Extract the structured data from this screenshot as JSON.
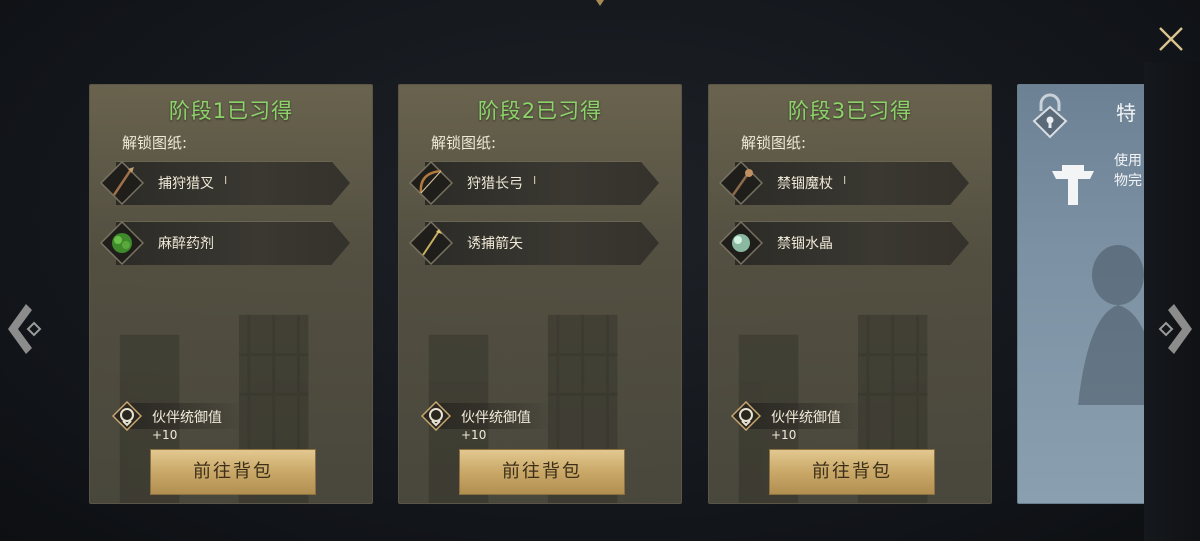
{
  "close": {
    "icon": "close-icon"
  },
  "cards": [
    {
      "title": "阶段1已习得",
      "unlock_label": "解锁图纸:",
      "items": [
        {
          "name": "捕狩猎叉",
          "tier": "I",
          "icon": "harpoon-icon"
        },
        {
          "name": "麻醉药剂",
          "tier": "",
          "icon": "herb-potion-icon"
        }
      ],
      "bonus_label": "伙伴统御值",
      "bonus_value": "+10",
      "button": "前往背包"
    },
    {
      "title": "阶段2已习得",
      "unlock_label": "解锁图纸:",
      "items": [
        {
          "name": "狩猎长弓",
          "tier": "I",
          "icon": "longbow-icon"
        },
        {
          "name": "诱捕箭矢",
          "tier": "",
          "icon": "arrow-icon"
        }
      ],
      "bonus_label": "伙伴统御值",
      "bonus_value": "+10",
      "button": "前往背包"
    },
    {
      "title": "阶段3已习得",
      "unlock_label": "解锁图纸:",
      "items": [
        {
          "name": "禁锢魔杖",
          "tier": "I",
          "icon": "staff-icon"
        },
        {
          "name": "禁锢水晶",
          "tier": "",
          "icon": "crystal-icon"
        }
      ],
      "bonus_label": "伙伴统御值",
      "bonus_value": "+10",
      "button": "前往背包"
    }
  ],
  "locked_card": {
    "title": "特",
    "desc_line1": "使用",
    "desc_line2": "物完",
    "lock_icon": "padlock-icon",
    "tool_icon": "anvil-tool-icon"
  },
  "colors": {
    "learned_title": "#8cd46a",
    "button_gold": "#c9a868",
    "locked_card": "#7c92a4"
  }
}
